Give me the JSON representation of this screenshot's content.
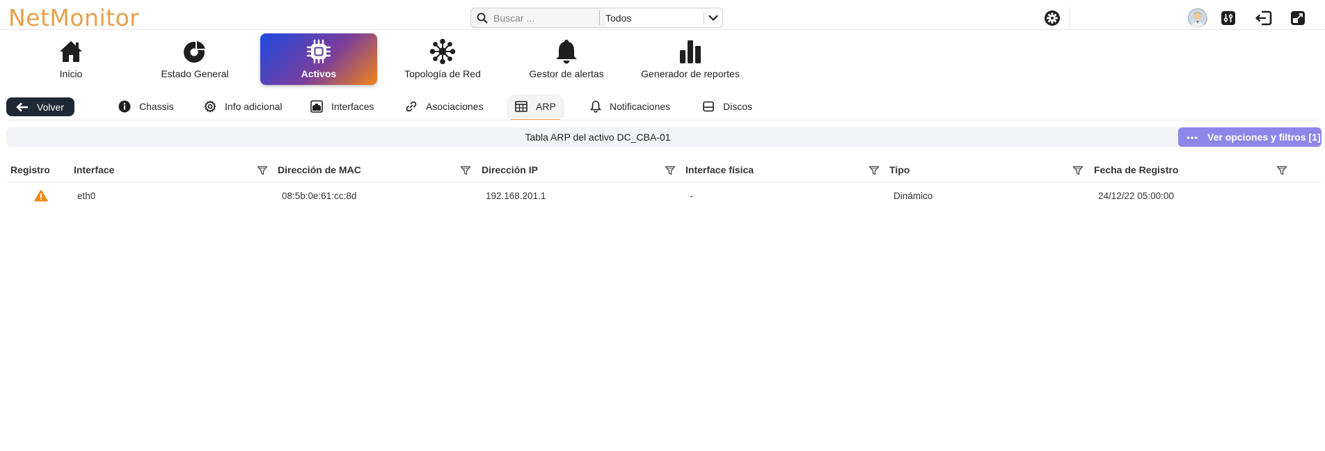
{
  "app": {
    "logo_text": "NetMonitor",
    "brand_color": "#e8a04a"
  },
  "search": {
    "placeholder": "Buscar ...",
    "value": "",
    "scope": "Todos"
  },
  "main_nav": [
    {
      "label": "Inicio",
      "icon": "home-icon"
    },
    {
      "label": "Estado General",
      "icon": "pie-chart-icon"
    },
    {
      "label": "Activos",
      "icon": "chip-icon",
      "active": true
    },
    {
      "label": "Topología de Red",
      "icon": "network-icon"
    },
    {
      "label": "Gestor de alertas",
      "icon": "bell-icon"
    },
    {
      "label": "Generador de reportes",
      "icon": "bar-chart-icon"
    }
  ],
  "back_button": {
    "label": "Volver"
  },
  "sub_tabs": [
    {
      "label": "Chassis",
      "icon": "info-icon"
    },
    {
      "label": "Info adicional",
      "icon": "gear-icon"
    },
    {
      "label": "Interfaces",
      "icon": "interfaces-icon"
    },
    {
      "label": "Asociaciones",
      "icon": "link-icon"
    },
    {
      "label": "ARP",
      "icon": "table-icon",
      "active": true
    },
    {
      "label": "Notificaciones",
      "icon": "bell-icon"
    },
    {
      "label": "Discos",
      "icon": "disk-icon"
    }
  ],
  "table": {
    "title": "Tabla ARP del activo DC_CBA-01",
    "options_label": "Ver opciones y filtros [1]",
    "columns": [
      "Registro",
      "Interface",
      "Dirección de MAC",
      "Dirección IP",
      "Interface física",
      "Tipo",
      "Fecha de Registro"
    ],
    "rows": [
      {
        "registro_icon": "warning-icon",
        "interface": "eth0",
        "mac": "08:5b:0e:61:cc:8d",
        "ip": "192.168.201.1",
        "interface_fisica": "-",
        "tipo": "Dinámico",
        "fecha": "24/12/22 05:00:00"
      }
    ]
  },
  "colors": {
    "warning": "#f08a1c",
    "options_button": "#8f86e9",
    "back_button": "#1f2933"
  }
}
